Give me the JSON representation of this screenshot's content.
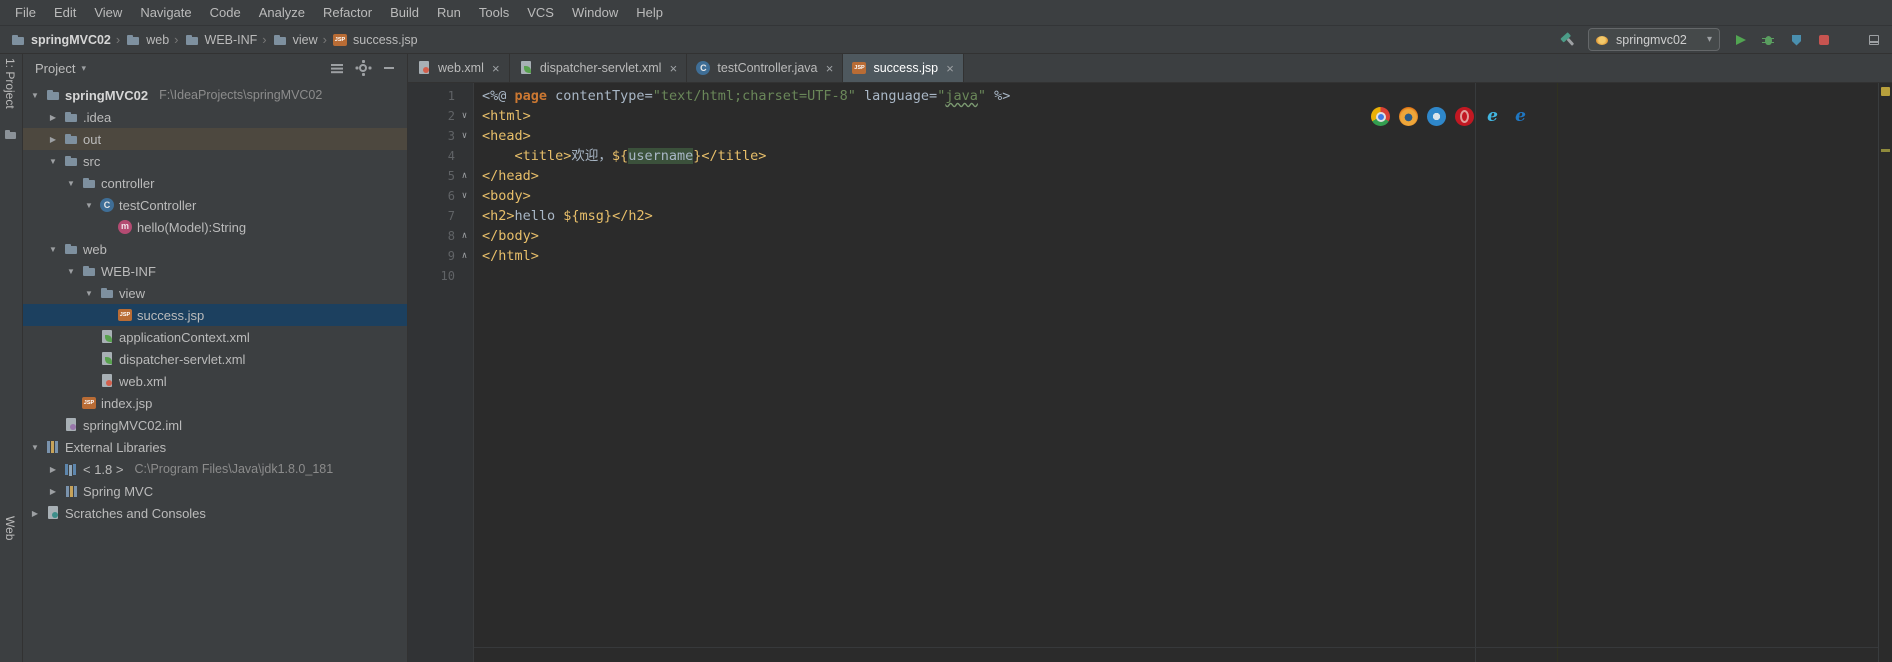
{
  "menu": {
    "items": [
      "File",
      "Edit",
      "View",
      "Navigate",
      "Code",
      "Analyze",
      "Refactor",
      "Build",
      "Run",
      "Tools",
      "VCS",
      "Window",
      "Help"
    ]
  },
  "breadcrumb": {
    "items": [
      {
        "label": "springMVC02",
        "icon": "folder",
        "bold": true
      },
      {
        "label": "web",
        "icon": "folder"
      },
      {
        "label": "WEB-INF",
        "icon": "folder"
      },
      {
        "label": "view",
        "icon": "folder"
      },
      {
        "label": "success.jsp",
        "icon": "jsp"
      }
    ]
  },
  "run_controls": {
    "config_name": "springmvc02",
    "icons": [
      "build-hammer-icon",
      "run-config-icon",
      "run-icon",
      "debug-icon",
      "coverage-icon",
      "stop-icon",
      "tool-windows-icon"
    ]
  },
  "tool_strip": {
    "top_button": "1: Project",
    "bottom_button": "Web"
  },
  "project_panel": {
    "title": "Project",
    "header_icons": [
      "collapse-all",
      "settings-gear",
      "hide-panel"
    ],
    "tree": [
      {
        "label": "springMVC02",
        "suffix": "F:\\IdeaProjects\\springMVC02",
        "icon": "folder",
        "level": 0,
        "arrow": "expanded",
        "bold": true
      },
      {
        "label": ".idea",
        "icon": "folder",
        "level": 1,
        "arrow": "collapsed"
      },
      {
        "label": "out",
        "icon": "folder",
        "level": 1,
        "arrow": "collapsed",
        "state": "hover"
      },
      {
        "label": "src",
        "icon": "folder",
        "level": 1,
        "arrow": "expanded"
      },
      {
        "label": "controller",
        "icon": "folder",
        "level": 2,
        "arrow": "expanded"
      },
      {
        "label": "testController",
        "icon": "class",
        "level": 3,
        "arrow": "expanded"
      },
      {
        "label": "hello(Model):String",
        "icon": "method",
        "level": 4
      },
      {
        "label": "web",
        "icon": "folder",
        "level": 1,
        "arrow": "expanded"
      },
      {
        "label": "WEB-INF",
        "icon": "folder",
        "level": 2,
        "arrow": "expanded"
      },
      {
        "label": "view",
        "icon": "folder",
        "level": 3,
        "arrow": "expanded"
      },
      {
        "label": "success.jsp",
        "icon": "jsp",
        "level": 4,
        "state": "selected"
      },
      {
        "label": "applicationContext.xml",
        "icon": "spring-xml",
        "level": 3
      },
      {
        "label": "dispatcher-servlet.xml",
        "icon": "spring-xml",
        "level": 3
      },
      {
        "label": "web.xml",
        "icon": "web-xml",
        "level": 3
      },
      {
        "label": "index.jsp",
        "icon": "jsp",
        "level": 2
      },
      {
        "label": "springMVC02.iml",
        "icon": "iml",
        "level": 1
      },
      {
        "label": "External Libraries",
        "icon": "libraries",
        "level": 0,
        "arrow": "expanded"
      },
      {
        "label": "< 1.8 >",
        "suffix": "C:\\Program Files\\Java\\jdk1.8.0_181",
        "icon": "jdk",
        "level": 1,
        "arrow": "collapsed"
      },
      {
        "label": "Spring MVC",
        "icon": "library",
        "level": 1,
        "arrow": "collapsed"
      },
      {
        "label": "Scratches and Consoles",
        "icon": "scratches",
        "level": 0,
        "arrow": "collapsed"
      }
    ]
  },
  "editor": {
    "tabs": [
      {
        "label": "web.xml",
        "icon": "web-xml",
        "active": false
      },
      {
        "label": "dispatcher-servlet.xml",
        "icon": "spring-xml",
        "active": false
      },
      {
        "label": "testController.java",
        "icon": "class",
        "active": false
      },
      {
        "label": "success.jsp",
        "icon": "jsp",
        "active": true
      }
    ],
    "browser_icons": [
      "chrome",
      "firefox",
      "safari",
      "opera",
      "ie",
      "edge"
    ],
    "lines": [
      {
        "num": "1",
        "fold": "",
        "segments": [
          {
            "t": "<%@ ",
            "c": "pl"
          },
          {
            "t": "page",
            "c": "kw"
          },
          {
            "t": " contentType=",
            "c": "pl"
          },
          {
            "t": "\"text/html;charset=UTF-8\"",
            "c": "str"
          },
          {
            "t": " language=",
            "c": "pl"
          },
          {
            "t": "\"",
            "c": "str"
          },
          {
            "t": "java",
            "c": "str typo"
          },
          {
            "t": "\"",
            "c": "str"
          },
          {
            "t": " %>",
            "c": "pl"
          }
        ]
      },
      {
        "num": "2",
        "fold": "down",
        "segments": [
          {
            "t": "<html>",
            "c": "tag"
          }
        ]
      },
      {
        "num": "3",
        "fold": "down",
        "segments": [
          {
            "t": "<head>",
            "c": "tag"
          }
        ]
      },
      {
        "num": "4",
        "fold": "",
        "segments": [
          {
            "t": "    ",
            "c": "pl"
          },
          {
            "t": "<title>",
            "c": "tag"
          },
          {
            "t": "欢迎，",
            "c": "pl"
          },
          {
            "t": "${",
            "c": "el"
          },
          {
            "t": "username",
            "c": "pl hl"
          },
          {
            "t": "}",
            "c": "el"
          },
          {
            "t": "</title>",
            "c": "tag"
          }
        ]
      },
      {
        "num": "5",
        "fold": "up",
        "segments": [
          {
            "t": "</head>",
            "c": "tag"
          }
        ]
      },
      {
        "num": "6",
        "fold": "down",
        "segments": [
          {
            "t": "<body>",
            "c": "tag"
          }
        ]
      },
      {
        "num": "7",
        "fold": "",
        "segments": [
          {
            "t": "<h2>",
            "c": "tag"
          },
          {
            "t": "hello ",
            "c": "pl"
          },
          {
            "t": "${msg}",
            "c": "el"
          },
          {
            "t": "</h2>",
            "c": "tag"
          }
        ]
      },
      {
        "num": "8",
        "fold": "up",
        "segments": [
          {
            "t": "</body>",
            "c": "tag"
          }
        ]
      },
      {
        "num": "9",
        "fold": "up",
        "segments": [
          {
            "t": "</html>",
            "c": "tag"
          }
        ]
      },
      {
        "num": "10",
        "fold": "",
        "segments": []
      }
    ]
  }
}
